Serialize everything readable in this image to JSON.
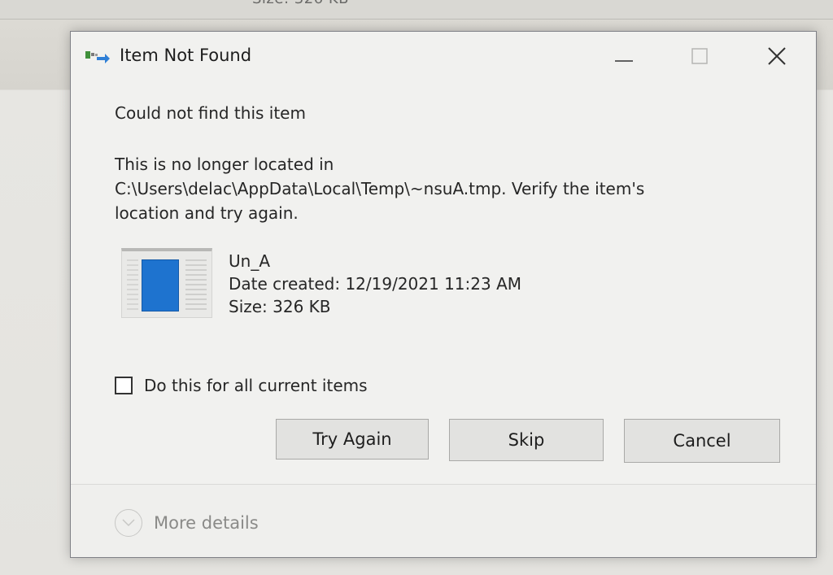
{
  "background": {
    "partial_text": "Size: 326 KB"
  },
  "dialog": {
    "title": "Item Not Found",
    "heading": "Could not find this item",
    "message_line1": "This is no longer located in",
    "message_line2": "C:\\Users\\delac\\AppData\\Local\\Temp\\~nsuA.tmp. Verify the item's",
    "message_line3": "location and try again.",
    "file": {
      "name": "Un_A",
      "date_created": "Date created: 12/19/2021 11:23 AM",
      "size": "Size: 326 KB"
    },
    "checkbox": {
      "label": "Do this for all current items",
      "checked": false
    },
    "buttons": {
      "try_again": "Try Again",
      "skip": "Skip",
      "cancel": "Cancel"
    },
    "more_details": "More details"
  },
  "colors": {
    "file_icon_blue": "#1e73cf",
    "dialog_bg": "#f1f1ef",
    "button_bg": "#e2e2e0"
  },
  "icons": [
    "app-icon",
    "minimize-icon",
    "maximize-icon",
    "close-icon",
    "file-thumbnail-icon",
    "chevron-down-icon"
  ]
}
